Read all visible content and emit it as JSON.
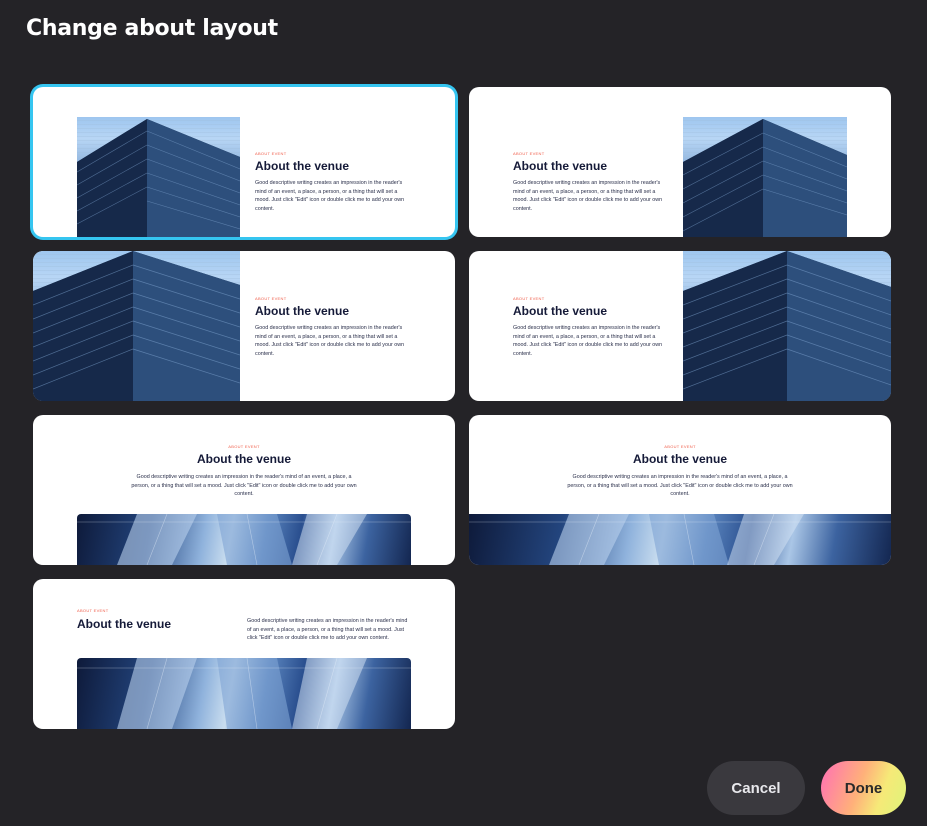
{
  "dialog": {
    "title": "Change about layout"
  },
  "layout_preview": {
    "eyebrow": "ABOUT EVENT",
    "heading": "About the venue",
    "body": "Good descriptive writing creates an impression in the reader's mind of an event, a place, a person, or a thing that will set a mood. Just click \"Edit\" icon or double click me to add your own content."
  },
  "layouts": [
    {
      "id": "image-left-inset",
      "selected": true
    },
    {
      "id": "image-right-inset",
      "selected": false
    },
    {
      "id": "image-left-full",
      "selected": false
    },
    {
      "id": "image-right-full",
      "selected": false
    },
    {
      "id": "text-top-image-bottom-inset",
      "selected": false
    },
    {
      "id": "text-top-image-bottom-full",
      "selected": false
    },
    {
      "id": "split-text-image-bottom",
      "selected": false
    }
  ],
  "buttons": {
    "cancel": "Cancel",
    "done": "Done"
  },
  "colors": {
    "background": "#242327",
    "selected_outline": "#35c5f0",
    "eyebrow": "#f0604d",
    "heading": "#151a38"
  }
}
